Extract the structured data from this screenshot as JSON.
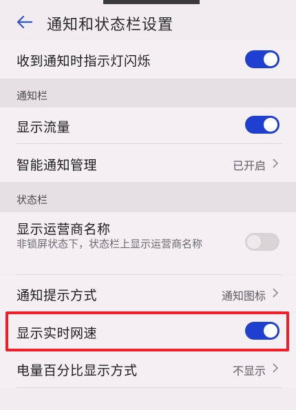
{
  "header": {
    "title": "通知和状态栏设置"
  },
  "rows": {
    "blink": {
      "label": "收到通知时指示灯闪烁",
      "toggle": "on"
    },
    "show_traffic": {
      "label": "显示流量",
      "toggle": "on"
    },
    "smart_notify": {
      "label": "智能通知管理",
      "value": "已开启"
    },
    "carrier": {
      "label": "显示运营商名称",
      "sub": "非锁屏状态下，状态栏上显示运营商名称",
      "toggle": "off"
    },
    "notify_style": {
      "label": "通知提示方式",
      "value": "通知图标"
    },
    "net_speed": {
      "label": "显示实时网速",
      "toggle": "on"
    },
    "battery_percent": {
      "label": "电量百分比显示方式",
      "value": "不显示"
    }
  },
  "sections": {
    "notification_bar": "通知栏",
    "status_bar": "状态栏"
  },
  "colors": {
    "accent": "#1e3fcf",
    "highlight": "#f01e28"
  }
}
